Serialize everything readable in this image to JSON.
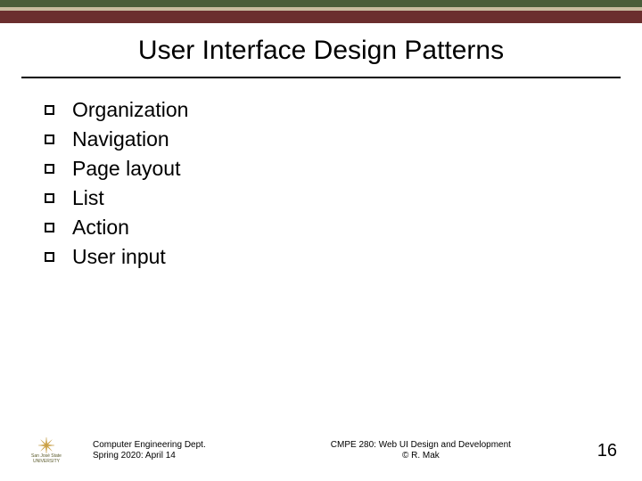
{
  "title": "User Interface Design Patterns",
  "bullets": [
    "Organization",
    "Navigation",
    "Page layout",
    "List",
    "Action",
    "User input"
  ],
  "footer": {
    "dept_line1": "Computer Engineering Dept.",
    "dept_line2": "Spring 2020: April 14",
    "course_line1": "CMPE 280: Web UI Design and Development",
    "course_line2": "© R. Mak",
    "logo_name": "San José State",
    "logo_sub": "UNIVERSITY"
  },
  "page_number": "16"
}
